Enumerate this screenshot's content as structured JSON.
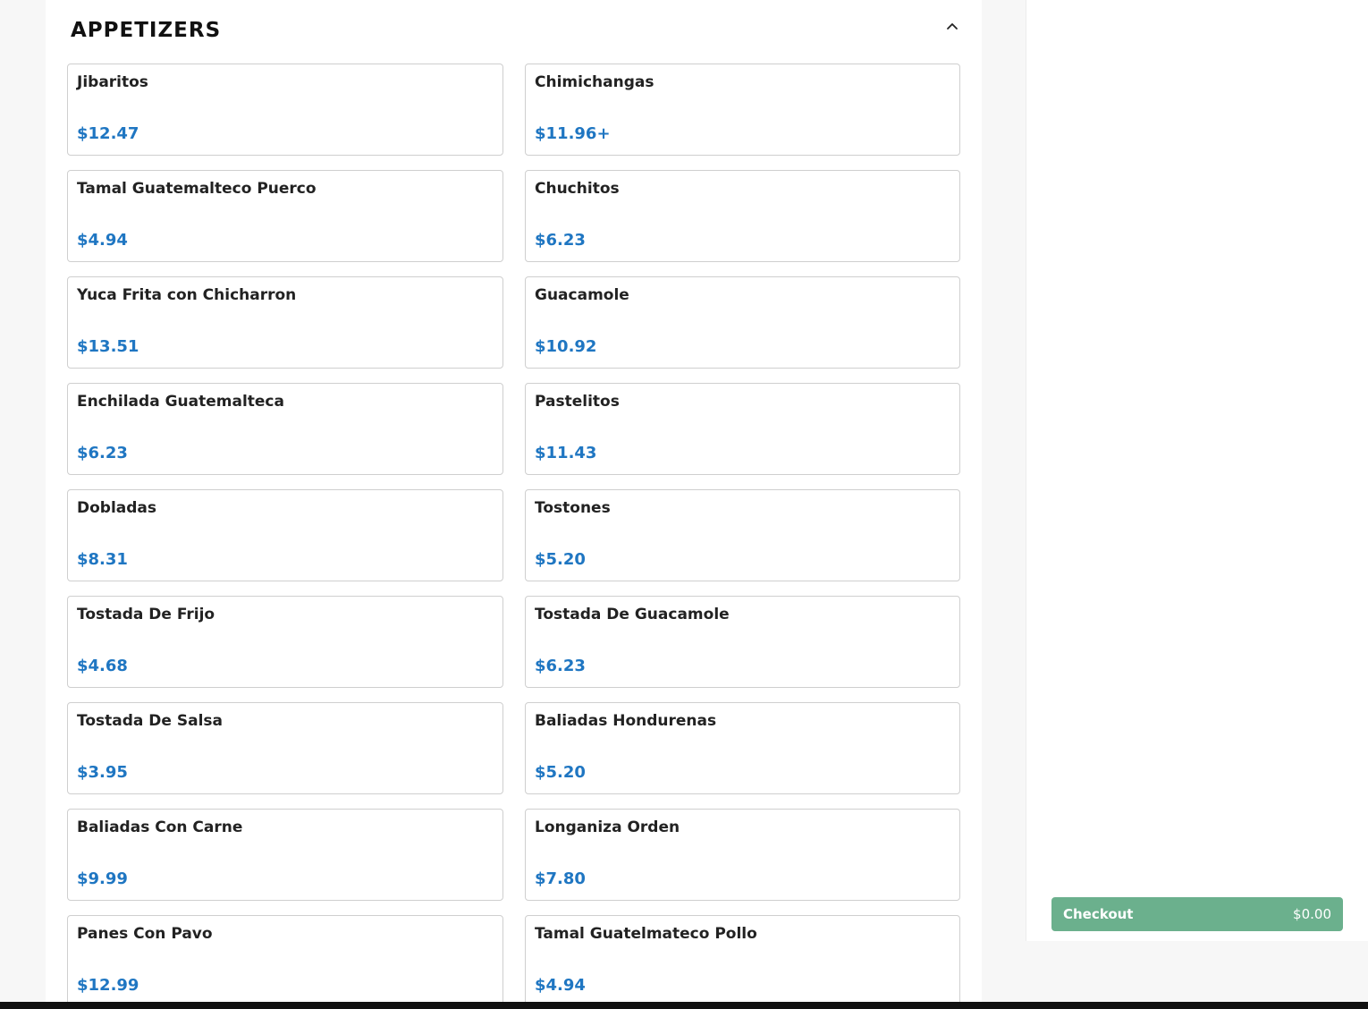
{
  "section": {
    "title": "APPETIZERS",
    "toggle_icon": "chevron-up-icon"
  },
  "items": [
    {
      "name": "Jibaritos",
      "price": "$12.47"
    },
    {
      "name": "Chimichangas",
      "price": "$11.96+"
    },
    {
      "name": "Tamal Guatemalteco Puerco",
      "price": "$4.94"
    },
    {
      "name": "Chuchitos",
      "price": "$6.23"
    },
    {
      "name": "Yuca Frita con Chicharron",
      "price": "$13.51"
    },
    {
      "name": "Guacamole",
      "price": "$10.92"
    },
    {
      "name": "Enchilada Guatemalteca",
      "price": "$6.23"
    },
    {
      "name": "Pastelitos",
      "price": "$11.43"
    },
    {
      "name": "Dobladas",
      "price": "$8.31"
    },
    {
      "name": "Tostones",
      "price": "$5.20"
    },
    {
      "name": "Tostada De Frijo",
      "price": "$4.68"
    },
    {
      "name": "Tostada De Guacamole",
      "price": "$6.23"
    },
    {
      "name": "Tostada De Salsa",
      "price": "$3.95"
    },
    {
      "name": "Baliadas Hondurenas",
      "price": "$5.20"
    },
    {
      "name": "Baliadas Con Carne",
      "price": "$9.99"
    },
    {
      "name": "Longaniza Orden",
      "price": "$7.80"
    },
    {
      "name": "Panes Con Pavo",
      "price": "$12.99"
    },
    {
      "name": "Tamal Guatelmateco Pollo",
      "price": "$4.94"
    }
  ],
  "cart": {
    "checkout_label": "Checkout",
    "total": "$0.00"
  },
  "colors": {
    "price": "#1f76c2",
    "checkout_button": "#6bb08d",
    "card_border": "#cfcfcf"
  }
}
